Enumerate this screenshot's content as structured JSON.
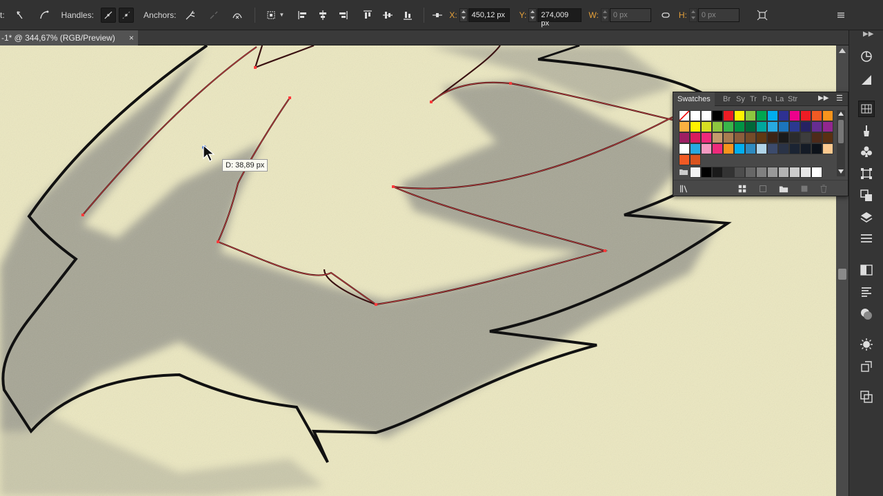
{
  "control_bar": {
    "tool_fragment": "t:",
    "handles_label": "Handles:",
    "anchors_label": "Anchors:",
    "x_label": "X:",
    "x_value": "450,12 px",
    "y_label": "Y:",
    "y_value": "274,009 px",
    "w_label": "W:",
    "w_value": "0 px",
    "h_label": "H:",
    "h_value": "0 px"
  },
  "document": {
    "tab_title": "-1* @ 344,67% (RGB/Preview)",
    "close_glyph": "×"
  },
  "tooltip": {
    "distance": "D: 38,89 px"
  },
  "swatches_panel": {
    "active_tab": "Swatches",
    "other_tabs": [
      "Br",
      "Sy",
      "Tr",
      "Pa",
      "La",
      "Str"
    ],
    "rows": [
      [
        "none",
        "#ffffff",
        "#ffffff",
        "#000000",
        "#ed1c24",
        "#fff200",
        "#8dc63f",
        "#00a651",
        "#00aeef",
        "#2e3192",
        "#ec008c",
        "#ed1c24",
        "#f15a24",
        "#f7941d"
      ],
      [
        "#fbb040",
        "#fff200",
        "#d7df23",
        "#8dc63f",
        "#39b54a",
        "#009444",
        "#006838",
        "#00a79d",
        "#27aae1",
        "#1c75bc",
        "#2b3990",
        "#262262",
        "#662d91",
        "#92278f"
      ],
      [
        "#9e1f63",
        "#da1c5c",
        "#ee2a7b",
        "#c49a6c",
        "#a97c50",
        "#8b5e3c",
        "#754c29",
        "#603913",
        "#3c2415",
        "#1a1a1a",
        "#2b2b2b",
        "#3d3d3d",
        "#4d2a1a",
        "#5a3012"
      ],
      [
        "#ffffff",
        "#27aae1",
        "#f49ac1",
        "#ee2a7b",
        "#f7941d",
        "#00aeef",
        "#2e8bc0",
        "#b0d4e8",
        "#3c4b6c",
        "#2a3346",
        "#1b2433",
        "#141b26",
        "#0d121a",
        "#fbc98f"
      ],
      [
        "#f15a24",
        "#d9531e"
      ]
    ],
    "gray_row": [
      "#f2f2f2",
      "#000000",
      "#1a1a1a",
      "#333333",
      "#4d4d4d",
      "#666666",
      "#808080",
      "#999999",
      "#b3b3b3",
      "#cccccc",
      "#e6e6e6",
      "#ffffff"
    ]
  },
  "dock_icons": [
    "color-guide-icon",
    "gradient-icon",
    "swatches-icon",
    "brushes-icon",
    "symbols-icon",
    "transform-icon",
    "pathfinder-icon",
    "layers-icon",
    "align-icon",
    "transparency-icon",
    "graphic-styles-icon",
    "appearance-icon",
    "artboards-icon",
    "links-icon"
  ]
}
